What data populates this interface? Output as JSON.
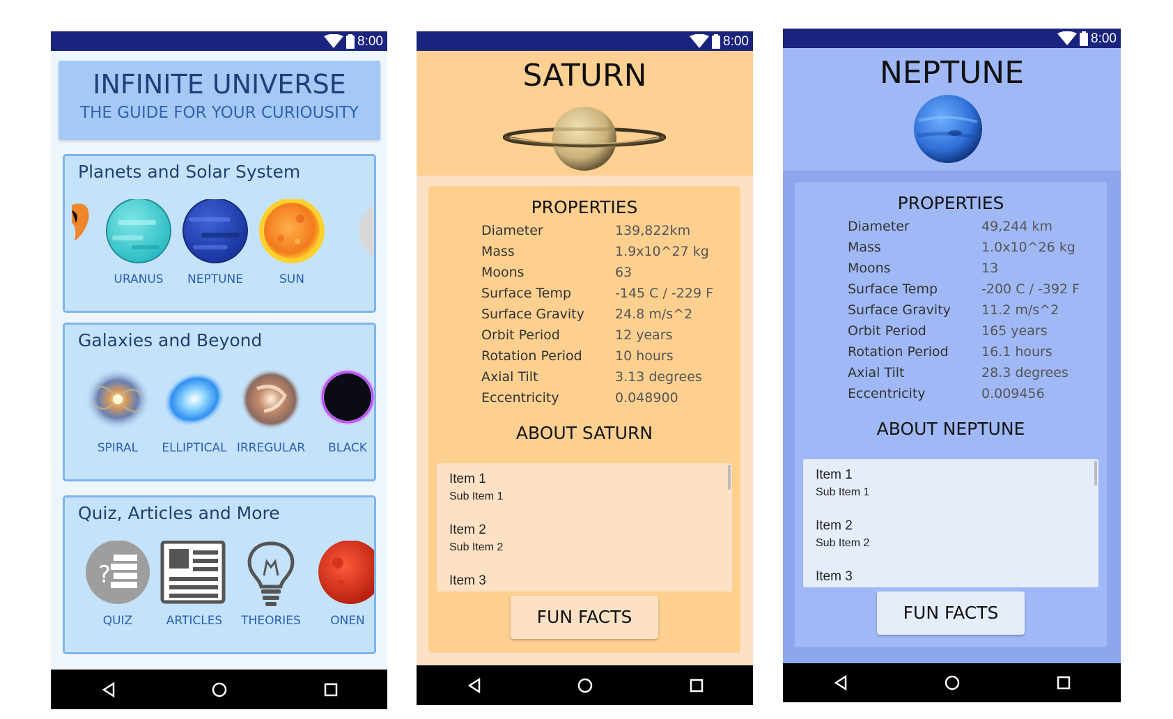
{
  "status_bar": {
    "time": "8:00"
  },
  "home": {
    "title": "INFINITE UNIVERSE",
    "subtitle": "THE GUIDE FOR YOUR CURIOUSITY",
    "sections": [
      {
        "title": "Planets and Solar System",
        "items": [
          "URANUS",
          "NEPTUNE",
          "SUN"
        ]
      },
      {
        "title": "Galaxies and Beyond",
        "items": [
          "SPIRAL",
          "ELLIPTICAL",
          "IRREGULAR",
          "BLACK"
        ]
      },
      {
        "title": "Quiz, Articles and More",
        "items": [
          "QUIZ",
          "ARTICLES",
          "THEORIES",
          "ONEN"
        ]
      }
    ]
  },
  "saturn": {
    "title": "SATURN",
    "properties_title": "PROPERTIES",
    "properties": [
      {
        "key": "Diameter",
        "value": "139,822km"
      },
      {
        "key": "Mass",
        "value": "1.9x10^27 kg"
      },
      {
        "key": "Moons",
        "value": "63"
      },
      {
        "key": "Surface Temp",
        "value": "-145 C / -229 F"
      },
      {
        "key": "Surface Gravity",
        "value": "24.8 m/s^2"
      },
      {
        "key": "Orbit Period",
        "value": "12 years"
      },
      {
        "key": "Rotation Period",
        "value": "10 hours"
      },
      {
        "key": "Axial Tilt",
        "value": "3.13 degrees"
      },
      {
        "key": "Eccentricity",
        "value": "0.048900"
      }
    ],
    "about_title": "ABOUT SATURN",
    "list": [
      {
        "item": "Item 1",
        "sub": "Sub Item 1"
      },
      {
        "item": "Item 2",
        "sub": "Sub Item 2"
      },
      {
        "item": "Item 3",
        "sub": ""
      }
    ],
    "button": "FUN FACTS"
  },
  "neptune": {
    "title": "NEPTUNE",
    "properties_title": "PROPERTIES",
    "properties": [
      {
        "key": "Diameter",
        "value": "49,244 km"
      },
      {
        "key": "Mass",
        "value": "1.0x10^26 kg"
      },
      {
        "key": "Moons",
        "value": "13"
      },
      {
        "key": "Surface Temp",
        "value": "-200 C / -392 F"
      },
      {
        "key": "Surface Gravity",
        "value": "11.2 m/s^2"
      },
      {
        "key": "Orbit Period",
        "value": "165 years"
      },
      {
        "key": "Rotation Period",
        "value": "16.1 hours"
      },
      {
        "key": "Axial Tilt",
        "value": "28.3 degrees"
      },
      {
        "key": "Eccentricity",
        "value": "0.009456"
      }
    ],
    "about_title": "ABOUT NEPTUNE",
    "list": [
      {
        "item": "Item 1",
        "sub": "Sub Item 1"
      },
      {
        "item": "Item 2",
        "sub": "Sub Item 2"
      },
      {
        "item": "Item 3",
        "sub": ""
      }
    ],
    "button": "FUN FACTS"
  }
}
